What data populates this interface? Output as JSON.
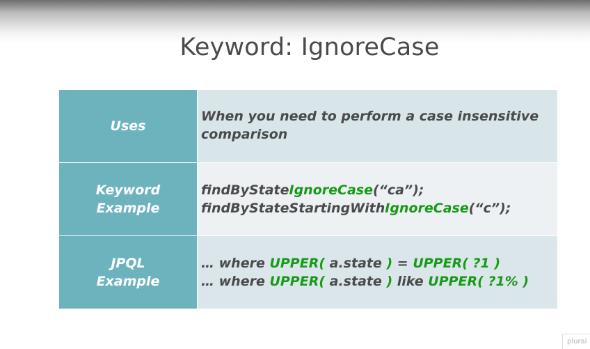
{
  "slide": {
    "title": "Keyword: IgnoreCase",
    "watermark": "plural"
  },
  "table": {
    "rows": [
      {
        "header": [
          "Uses"
        ],
        "content": {
          "line1": "When you need to perform a case insensitive",
          "line2": "comparison"
        }
      },
      {
        "header": [
          "Keyword",
          "Example"
        ],
        "content": {
          "line1": {
            "a": "findByState",
            "b": "IgnoreCase",
            "c": "(“ca”);"
          },
          "line2": {
            "a": "findByStateStartingWith",
            "b": "IgnoreCase",
            "c": "(“c”);"
          }
        }
      },
      {
        "header": [
          "JPQL",
          "Example"
        ],
        "content": {
          "line1": {
            "a": "… where ",
            "b": "UPPER(",
            "c": " a.state ",
            "d": ")",
            "e": " = ",
            "f": "UPPER(",
            "g": " ?1 ",
            "h": ")"
          },
          "line2": {
            "a": "… where ",
            "b": "UPPER(",
            "c": " a.state ",
            "d": ")",
            "e": " like ",
            "f": "UPPER(",
            "g": " ?1% ",
            "h": ")"
          }
        }
      }
    ]
  },
  "colors": {
    "header_bg": "#6db3be",
    "keyword_green": "#179a17",
    "text_dark": "#4a4a4a"
  }
}
